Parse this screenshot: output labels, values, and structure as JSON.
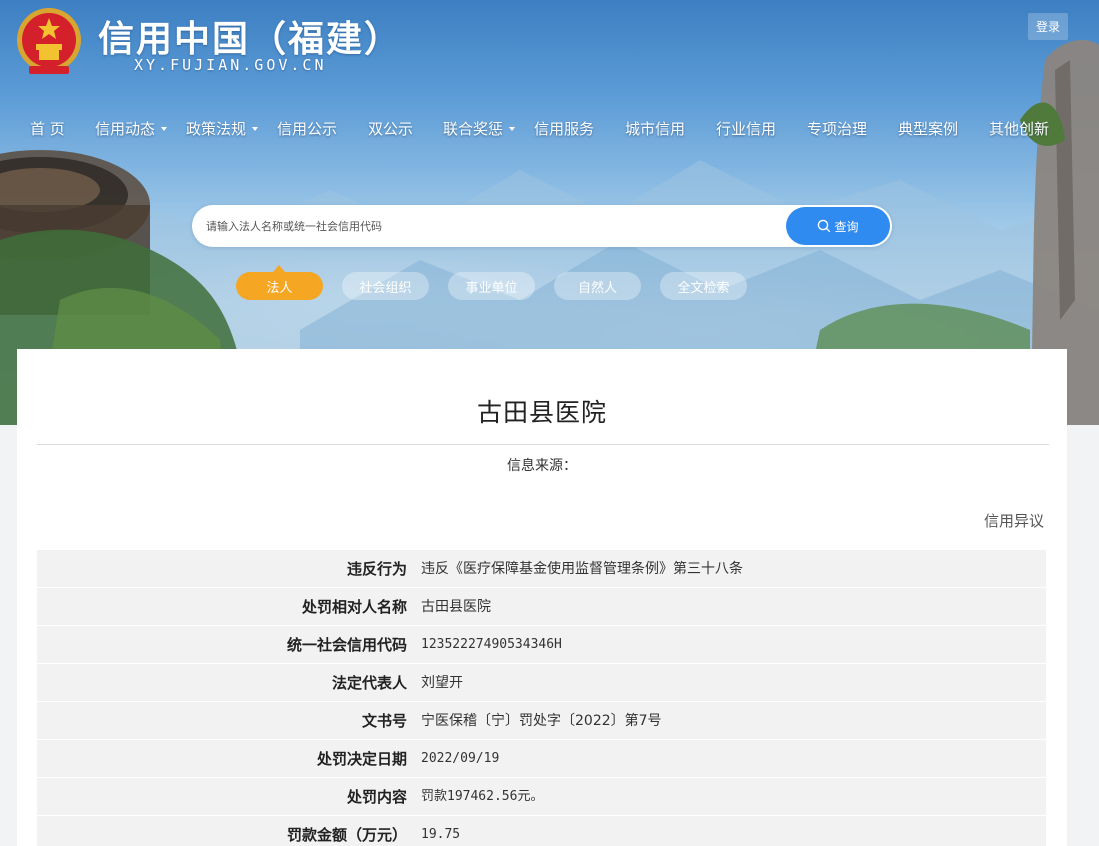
{
  "header": {
    "site_title": "信用中国（福建）",
    "site_domain": "XY.FUJIAN.GOV.CN",
    "login_label": "登录"
  },
  "nav": {
    "items": [
      {
        "label": "首 页",
        "has_dropdown": false
      },
      {
        "label": "信用动态",
        "has_dropdown": true
      },
      {
        "label": "政策法规",
        "has_dropdown": true
      },
      {
        "label": "信用公示",
        "has_dropdown": false
      },
      {
        "label": "双公示",
        "has_dropdown": false
      },
      {
        "label": "联合奖惩",
        "has_dropdown": true
      },
      {
        "label": "信用服务",
        "has_dropdown": false
      },
      {
        "label": "城市信用",
        "has_dropdown": false
      },
      {
        "label": "行业信用",
        "has_dropdown": false
      },
      {
        "label": "专项治理",
        "has_dropdown": false
      },
      {
        "label": "典型案例",
        "has_dropdown": false
      },
      {
        "label": "其他创新",
        "has_dropdown": false
      }
    ]
  },
  "search": {
    "placeholder": "请输入法人名称或统一社会信用代码",
    "button_label": "查询"
  },
  "type_tabs": [
    {
      "label": "法人",
      "active": true
    },
    {
      "label": "社会组织",
      "active": false
    },
    {
      "label": "事业单位",
      "active": false
    },
    {
      "label": "自然人",
      "active": false
    },
    {
      "label": "全文检索",
      "active": false
    }
  ],
  "record": {
    "title": "古田县医院",
    "source_label": "信息来源：",
    "objection_label": "信用异议",
    "fields": [
      {
        "key": "违反行为",
        "value": "违反《医疗保障基金使用监督管理条例》第三十八条"
      },
      {
        "key": "处罚相对人名称",
        "value": "古田县医院"
      },
      {
        "key": "统一社会信用代码",
        "value": "12352227490534346H"
      },
      {
        "key": "法定代表人",
        "value": "刘望开"
      },
      {
        "key": "文书号",
        "value": "宁医保稽〔宁〕罚处字〔2022〕第7号"
      },
      {
        "key": "处罚决定日期",
        "value": "2022/09/19"
      },
      {
        "key": "处罚内容",
        "value": "罚款197462.56元。"
      },
      {
        "key": "罚款金额（万元）",
        "value": "19.75"
      }
    ]
  },
  "colors": {
    "accent_blue": "#2f8bf0",
    "active_tab": "#f5a623",
    "row_bg": "#f2f2f2"
  }
}
